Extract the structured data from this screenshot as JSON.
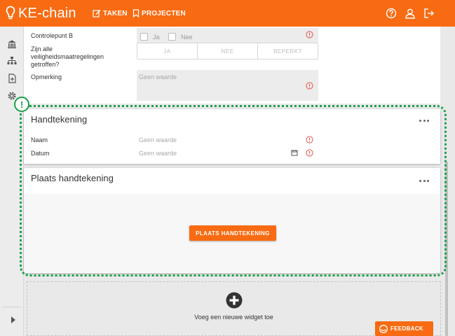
{
  "app": {
    "name": "KE-chain"
  },
  "topnav": {
    "tasks": "TAKEN",
    "projects": "PROJECTEN"
  },
  "topicons": [
    "help-icon",
    "user-icon",
    "logout-icon"
  ],
  "sidebar": {
    "icons": [
      "bank-icon",
      "sitemap-icon",
      "document-icon",
      "gear-icon",
      "expand-arrow-icon"
    ]
  },
  "form": {
    "controlepunt": {
      "label": "Controlepunt B",
      "options": [
        "Ja",
        "Nee"
      ]
    },
    "maatregelen": {
      "label": "Zijn alle veiligheidsmaatregelingen getroffen?",
      "options": [
        "JA",
        "NEE",
        "BEPERKT"
      ]
    },
    "opmerking": {
      "label": "Opmerking",
      "placeholder": "Geen waarde"
    }
  },
  "handtekening": {
    "title": "Handtekening",
    "fields": [
      {
        "label": "Naam",
        "placeholder": "Geen waarde"
      },
      {
        "label": "Datum",
        "placeholder": "Geen waarde"
      }
    ]
  },
  "plaats": {
    "title": "Plaats handtekening",
    "button": "PLAATS HANDTEKENING"
  },
  "add_widget": {
    "label": "Voeg een nieuwe widget toe"
  },
  "highlight_badge": "!",
  "feedback": "FEEDBACK",
  "colors": {
    "brand": "#f86b12",
    "highlight": "#1aa04a",
    "error": "#e5534b"
  }
}
